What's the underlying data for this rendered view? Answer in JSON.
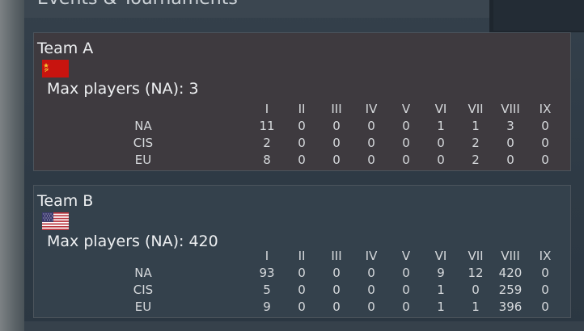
{
  "header": {
    "title": "Events & Tournaments"
  },
  "columns": [
    "I",
    "II",
    "III",
    "IV",
    "V",
    "VI",
    "VII",
    "VIII",
    "IX"
  ],
  "teams": [
    {
      "name": "Team A",
      "flag_icon": "ussr-flag-icon",
      "max_players": "Max players (NA): 3",
      "rows": [
        {
          "label": "NA",
          "values": [
            "11",
            "0",
            "0",
            "0",
            "0",
            "1",
            "1",
            "3",
            "0"
          ]
        },
        {
          "label": "CIS",
          "values": [
            "2",
            "0",
            "0",
            "0",
            "0",
            "0",
            "2",
            "0",
            "0"
          ]
        },
        {
          "label": "EU",
          "values": [
            "8",
            "0",
            "0",
            "0",
            "0",
            "0",
            "2",
            "0",
            "0"
          ]
        }
      ]
    },
    {
      "name": "Team B",
      "flag_icon": "usa-flag-icon",
      "max_players": "Max players (NA): 420",
      "rows": [
        {
          "label": "NA",
          "values": [
            "93",
            "0",
            "0",
            "0",
            "0",
            "9",
            "12",
            "420",
            "0"
          ]
        },
        {
          "label": "CIS",
          "values": [
            "5",
            "0",
            "0",
            "0",
            "0",
            "1",
            "0",
            "259",
            "0"
          ]
        },
        {
          "label": "EU",
          "values": [
            "9",
            "0",
            "0",
            "0",
            "0",
            "1",
            "1",
            "396",
            "0"
          ]
        }
      ]
    }
  ],
  "colors": {
    "team_a_bg": "#3e3a3f",
    "team_b_bg": "#34414c",
    "ussr_red": "#c8140f",
    "ussr_gold": "#f2c230",
    "usa_red": "#b8323c",
    "usa_blue": "#3c3b6e"
  }
}
